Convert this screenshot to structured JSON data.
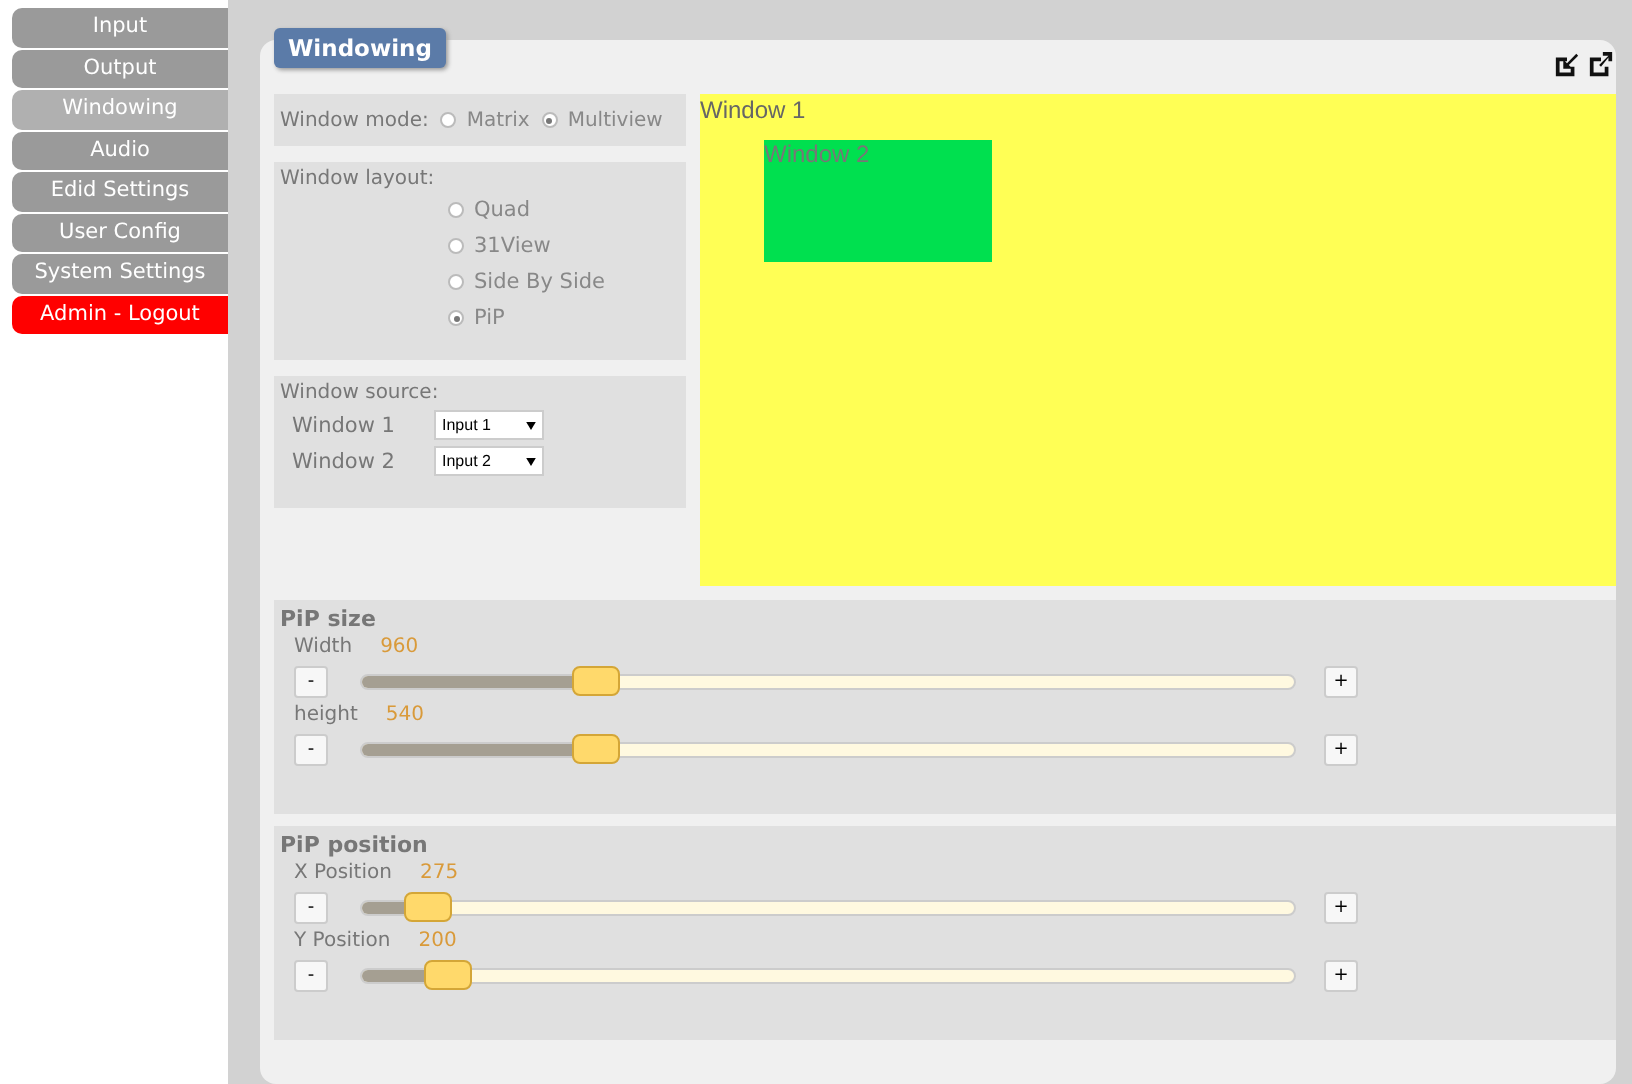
{
  "sidebar": {
    "items": [
      {
        "label": "Input",
        "selected": false,
        "kind": "nav"
      },
      {
        "label": "Output",
        "selected": false,
        "kind": "nav"
      },
      {
        "label": "Windowing",
        "selected": true,
        "kind": "nav"
      },
      {
        "label": "Audio",
        "selected": false,
        "kind": "nav"
      },
      {
        "label": "Edid Settings",
        "selected": false,
        "kind": "nav"
      },
      {
        "label": "User Config",
        "selected": false,
        "kind": "nav"
      },
      {
        "label": "System Settings",
        "selected": false,
        "kind": "nav"
      },
      {
        "label": "Admin - Logout",
        "selected": false,
        "kind": "logout"
      }
    ]
  },
  "panel": {
    "title": "Windowing",
    "window_mode": {
      "label": "Window mode:",
      "options": [
        {
          "label": "Matrix",
          "selected": false
        },
        {
          "label": "Multiview",
          "selected": true
        }
      ]
    },
    "window_layout": {
      "label": "Window layout:",
      "options": [
        {
          "label": "Quad",
          "selected": false
        },
        {
          "label": "31View",
          "selected": false
        },
        {
          "label": "Side By Side",
          "selected": false
        },
        {
          "label": "PiP",
          "selected": true
        }
      ]
    },
    "window_source": {
      "label": "Window source:",
      "rows": [
        {
          "label": "Window 1",
          "value": "Input 1"
        },
        {
          "label": "Window 2",
          "value": "Input 2"
        }
      ]
    },
    "preview": {
      "windows": [
        {
          "label": "Window 1",
          "color": "#ffff55"
        },
        {
          "label": "Window 2",
          "color": "#00e04f"
        }
      ]
    },
    "pip_size": {
      "title": "PiP size",
      "sliders": [
        {
          "label": "Width",
          "reading": "960",
          "level": 0.25,
          "minus": "-",
          "plus": "+"
        },
        {
          "label": "height",
          "reading": "540",
          "level": 0.25,
          "minus": "-",
          "plus": "+"
        }
      ]
    },
    "pip_position": {
      "title": "PiP position",
      "sliders": [
        {
          "label": "X Position",
          "reading": "275",
          "level": 0.07,
          "minus": "-",
          "plus": "+"
        },
        {
          "label": "Y Position",
          "reading": "200",
          "level": 0.093,
          "minus": "-",
          "plus": "+"
        }
      ]
    }
  }
}
